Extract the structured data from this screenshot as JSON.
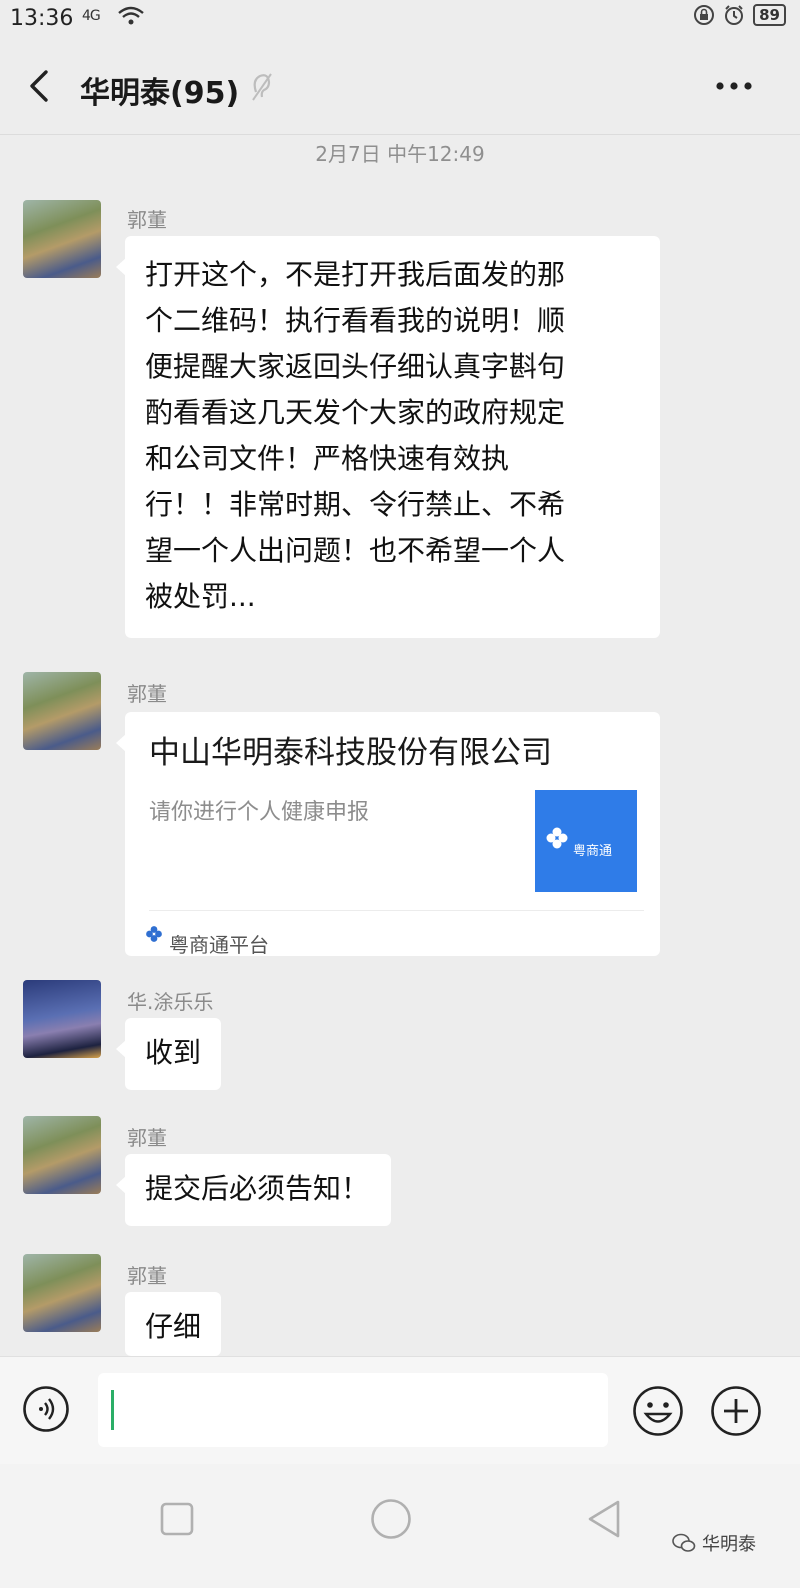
{
  "status_bar": {
    "time": "13:36",
    "network": "4G",
    "battery": "89"
  },
  "header": {
    "title": "华明泰(95)"
  },
  "timestamp": "2月7日 中午12:49",
  "messages": [
    {
      "sender": "郭董",
      "lines": [
        "打开这个，不是打开我后面发的那",
        "个二维码！执行看看我的说明！顺",
        "便提醒大家返回头仔细认真字斟句",
        "酌看看这几天发个大家的政府规定",
        "和公司文件！严格快速有效执",
        "行！！非常时期、令行禁止、不希",
        "望一个人出问题！也不希望一个人",
        "被处罚..."
      ]
    },
    {
      "sender": "郭董",
      "card": {
        "title": "中山华明泰科技股份有限公司",
        "description": "请你进行个人健康申报",
        "thumb_label": "粤商通",
        "source": "粤商通平台"
      }
    },
    {
      "sender": "华.涂乐乐",
      "text": "收到"
    },
    {
      "sender": "郭董",
      "text": "提交后必须告知！"
    },
    {
      "sender": "郭董",
      "text": "仔细"
    }
  ],
  "input": {
    "value": "",
    "placeholder": ""
  },
  "watermark": "华明泰",
  "colors": {
    "background": "#ededed",
    "bubble": "#ffffff",
    "cursor": "#2aae67",
    "card_thumb": "#2f7ce8"
  },
  "icons": [
    "back-arrow-icon",
    "mute-icon",
    "more-icon",
    "voice-icon",
    "emoji-icon",
    "plus-icon",
    "wifi-icon",
    "alarm-icon",
    "lock-icon"
  ]
}
